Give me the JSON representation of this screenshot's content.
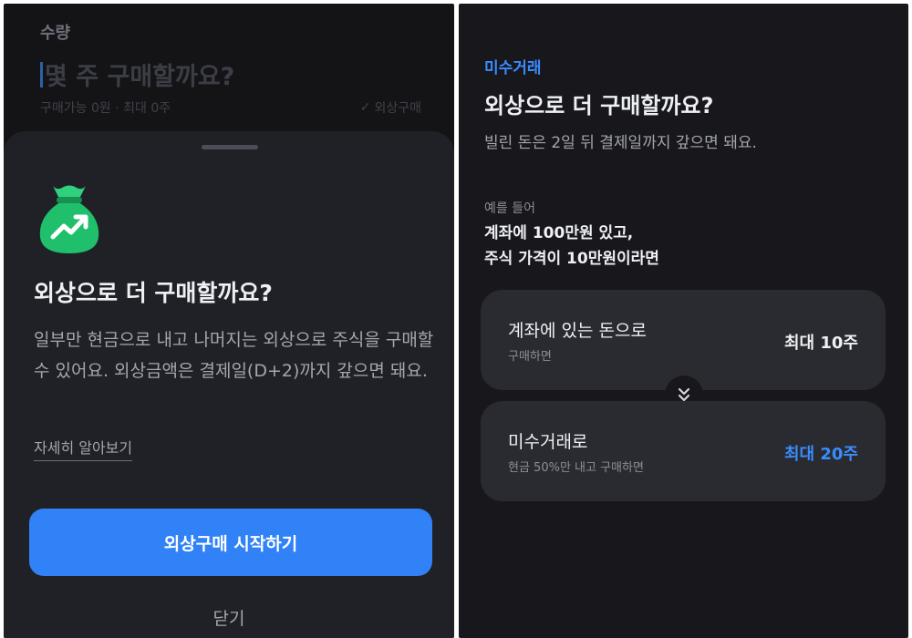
{
  "left": {
    "background": {
      "quantity_label": "수량",
      "question_placeholder": "몇 주 구매할까요?",
      "available_text": "구매가능 0원 · 최대 0주",
      "margin_toggle_label": "외상구매"
    },
    "sheet": {
      "title": "외상으로 더 구매할까요?",
      "description": "일부만 현금으로 내고 나머지는 외상으로 주식을 구매할 수 있어요. 외상금액은 결제일(D+2)까지 갚으면 돼요.",
      "learn_more_link": "자세히 알아보기",
      "start_button": "외상구매 시작하기",
      "close_button": "닫기",
      "icon": "money-bag-icon"
    }
  },
  "right": {
    "kicker": "미수거래",
    "title": "외상으로 더 구매할까요?",
    "subtitle": "빌린 돈은 2일 뒤 결제일까지 갚으면 돼요.",
    "example_label": "예를 들어",
    "example_line1": "계좌에 100만원 있고,",
    "example_line2": "주식 가격이 10만원이라면",
    "cards": [
      {
        "title": "계좌에 있는 돈으로",
        "subtitle": "구매하면",
        "value": "최대 10주"
      },
      {
        "title": "미수거래로",
        "subtitle": "현금 50%만 내고 구매하면",
        "value": "최대 20주"
      }
    ],
    "divider_icon": "double-chevron-down-icon"
  },
  "colors": {
    "accent": "#3182f6",
    "accent_text": "#3a8cff",
    "icon_green": "#1fbf6b"
  }
}
